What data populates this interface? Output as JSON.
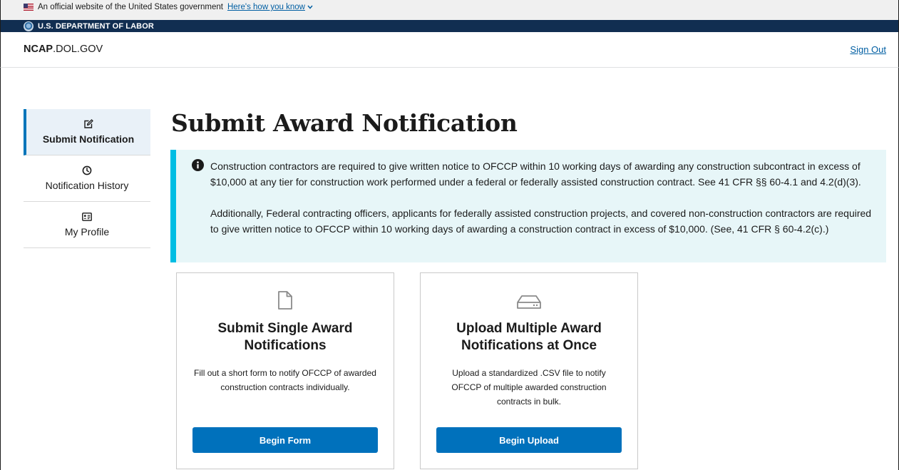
{
  "banner": {
    "official_text": "An official website of the United States government",
    "how_you_know": "Here's how you know"
  },
  "agency": {
    "name": "U.S. DEPARTMENT OF LABOR"
  },
  "header": {
    "site_title_bold": "NCAP",
    "site_title_rest": ".DOL.GOV",
    "sign_out": "Sign Out"
  },
  "sidebar": {
    "items": [
      {
        "label": "Submit Notification",
        "icon": "edit-icon",
        "active": true
      },
      {
        "label": "Notification History",
        "icon": "clock-icon",
        "active": false
      },
      {
        "label": "My Profile",
        "icon": "id-card-icon",
        "active": false
      }
    ]
  },
  "main": {
    "title": "Submit Award Notification",
    "alert": {
      "paragraph1": "Construction contractors are required to give written notice to OFCCP within 10 working days of awarding any construction subcontract in excess of $10,000 at any tier for construction work performed under a federal or federally assisted construction contract. See 41 CFR §§ 60-4.1 and 4.2(d)(3).",
      "paragraph2": "Additionally, Federal contracting officers, applicants for federally assisted construction projects, and covered non-construction contractors are required to give written notice to OFCCP within 10 working days of awarding a construction contract in excess of $10,000. (See, 41 CFR § 60-4.2(c).)"
    },
    "cards": [
      {
        "icon": "file-icon",
        "title": "Submit Single Award Notifications",
        "description": "Fill out a short form to notify OFCCP of awarded construction contracts individually.",
        "button": "Begin Form"
      },
      {
        "icon": "hard-drive-icon",
        "title": "Upload Multiple Award Notifications at Once",
        "description": "Upload a standardized .CSV file to notify OFCCP of multiple awarded construction contracts in bulk.",
        "button": "Begin Upload"
      }
    ]
  },
  "colors": {
    "primary_button": "#0071bc",
    "link": "#005ea2",
    "agency_bar": "#112e51",
    "alert_bg": "#e7f6f8",
    "alert_border": "#00bde3",
    "active_nav_border": "#0075ba"
  }
}
